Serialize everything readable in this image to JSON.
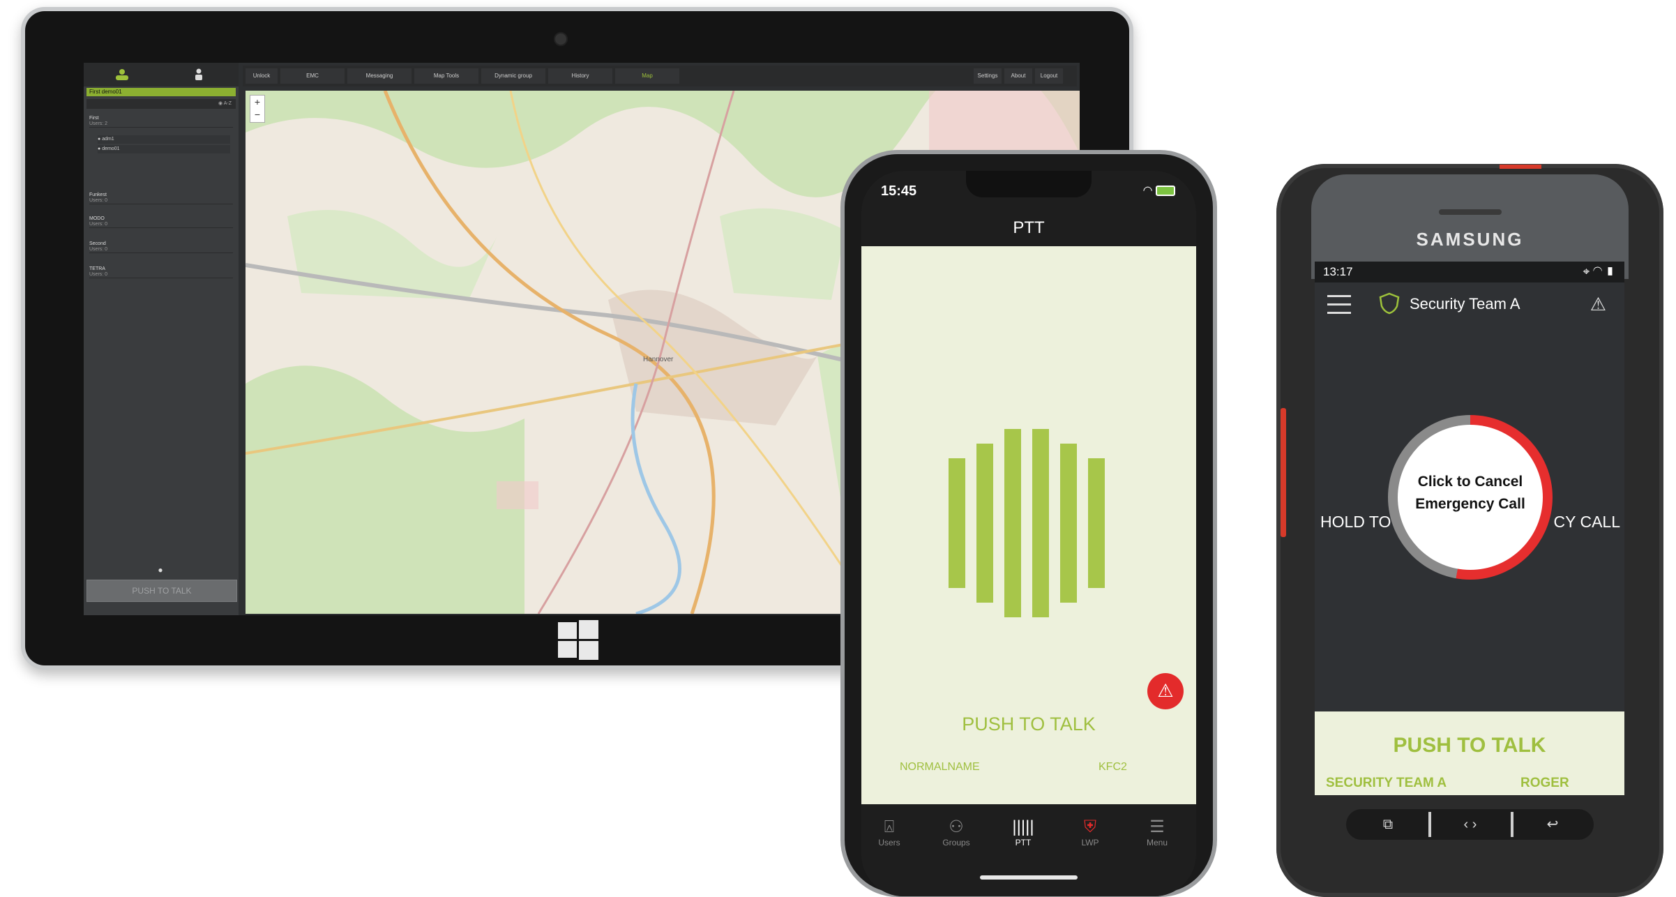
{
  "tablet": {
    "sidebar": {
      "selected_user": "First demo01",
      "search_hint": "A-Z",
      "groups": [
        {
          "name": "First",
          "sub": "Users: 2"
        },
        {
          "name": "Funkest",
          "sub": "Users: 0"
        },
        {
          "name": "MODO",
          "sub": "Users: 0"
        },
        {
          "name": "Second",
          "sub": "Users: 0"
        },
        {
          "name": "TETRA",
          "sub": "Users: 0"
        }
      ],
      "users": [
        "adm1",
        "demo01"
      ],
      "ptt_label": "PUSH TO TALK"
    },
    "nav": {
      "items": [
        "Unlock",
        "EMC",
        "Messaging",
        "Map Tools",
        "Dynamic group",
        "History",
        "Map",
        "Settings",
        "About",
        "Logout"
      ],
      "active": "Map"
    },
    "map_city_label": "Hannover"
  },
  "iphone": {
    "time": "15:45",
    "title": "PTT",
    "ptt_label": "PUSH TO TALK",
    "name": "NORMALNAME",
    "group": "KFC2",
    "tabs": [
      {
        "label": "Users",
        "icon": "users-icon"
      },
      {
        "label": "Groups",
        "icon": "groups-icon"
      },
      {
        "label": "PTT",
        "icon": "ptt-icon"
      },
      {
        "label": "LWP",
        "icon": "lwp-icon"
      },
      {
        "label": "Menu",
        "icon": "menu-icon"
      }
    ],
    "active_tab": "PTT",
    "accent": "#a7c64a",
    "emergency_color": "#e32b2b"
  },
  "samsung": {
    "brand": "SAMSUNG",
    "time": "13:17",
    "title": "Security Team A",
    "hold_text_left": "HOLD TO",
    "hold_text_right": "CY CALL",
    "cancel_text": "Click to Cancel Emergency Call",
    "ptt_label": "PUSH TO TALK",
    "team": "SECURITY TEAM A",
    "roger": "ROGER"
  }
}
